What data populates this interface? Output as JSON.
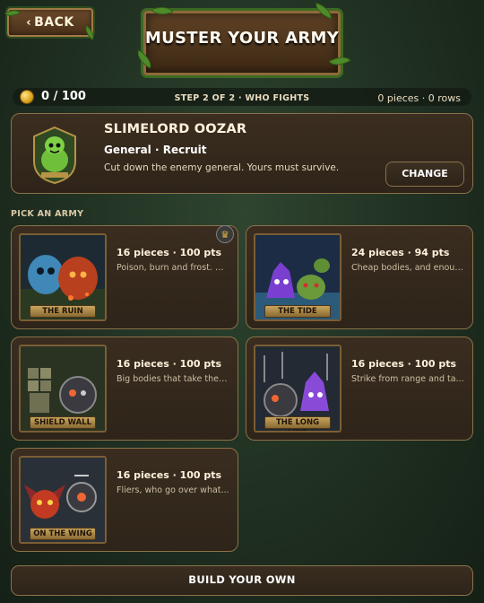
{
  "header": {
    "back_label": "BACK",
    "title": "MUSTER YOUR ARMY"
  },
  "status": {
    "coins": "0 / 100",
    "step": "STEP 2 OF 2 · WHO FIGHTS",
    "counts": "0 pieces · 0 rows"
  },
  "general": {
    "name": "SLIMELORD OOZAR",
    "role": "General · Recruit",
    "description": "Cut down the enemy general. Yours must survive.",
    "change_label": "CHANGE"
  },
  "pick_label": "PICK AN ARMY",
  "armies": [
    {
      "label": "THE RUIN",
      "stats": "16 pieces · 100 pts",
      "desc": "Poison, burn and frost. W...",
      "featured": true
    },
    {
      "label": "THE TIDE",
      "stats": "24 pieces · 94 pts",
      "desc": "Cheap bodies, and enoug..."
    },
    {
      "label": "SHIELD WALL",
      "stats": "16 pieces · 100 pts",
      "desc": "Big bodies that take the ..."
    },
    {
      "label": "THE LONG LINE",
      "stats": "16 pieces · 100 pts",
      "desc": "Strike from range and ta..."
    },
    {
      "label": "ON THE WING",
      "stats": "16 pieces · 100 pts",
      "desc": "Fliers, who go over what..."
    }
  ],
  "build_label": "BUILD YOUR OWN",
  "icons": {
    "back": "chevron-left-icon",
    "coin": "coin-icon",
    "featured": "crown-icon"
  }
}
